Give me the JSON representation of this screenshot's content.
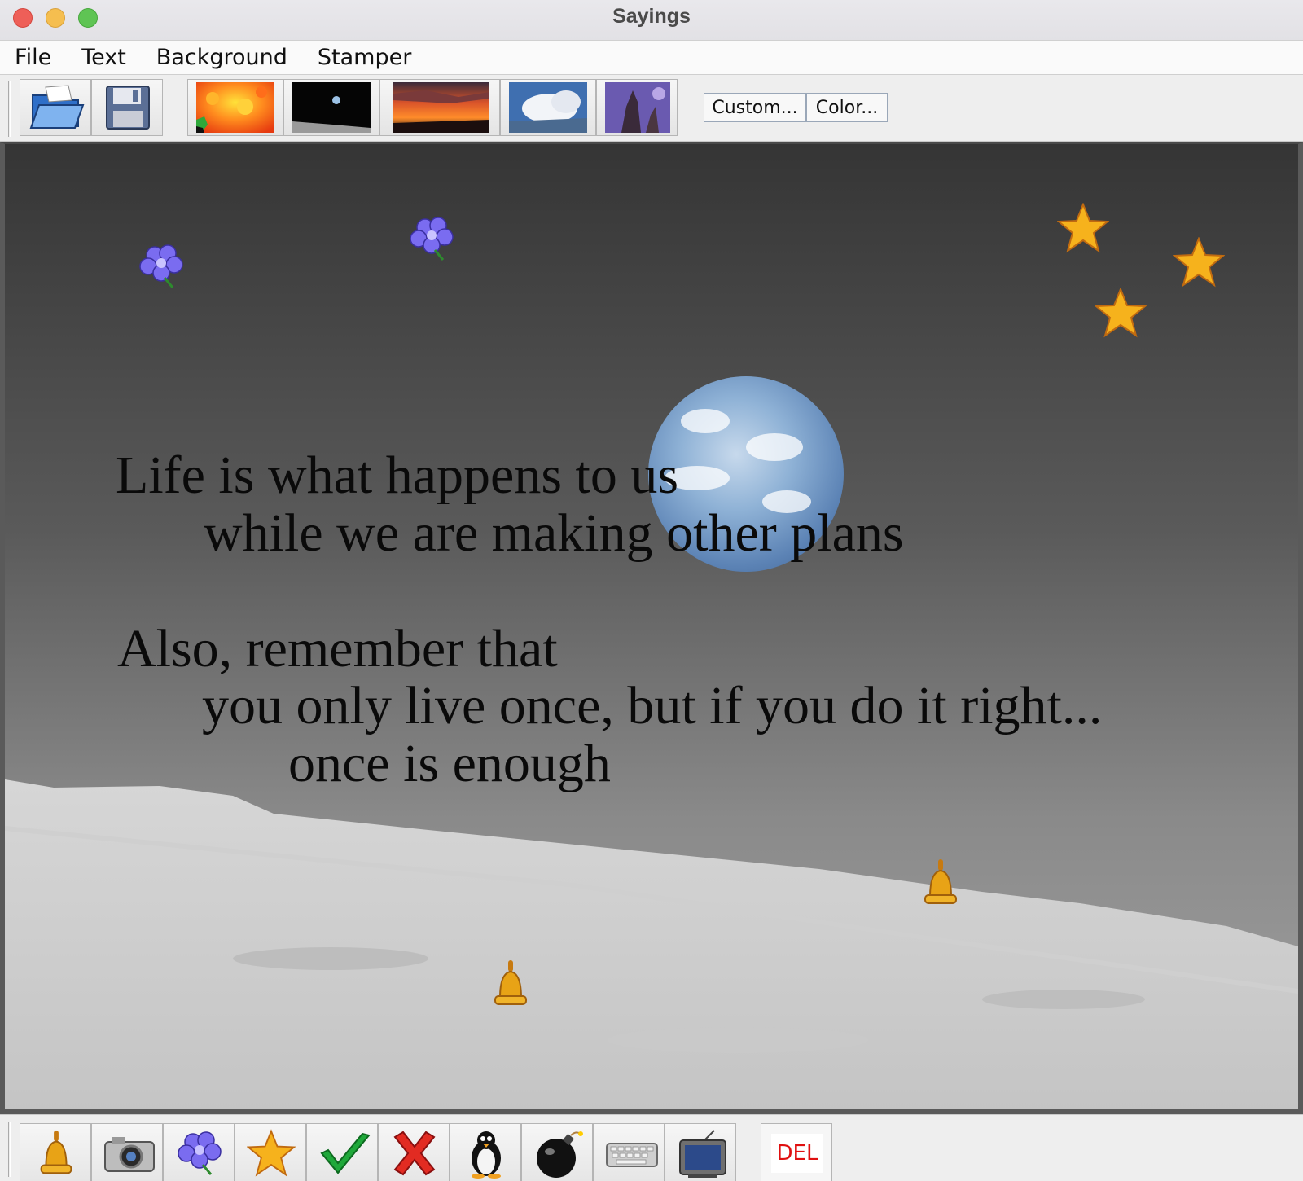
{
  "window": {
    "title": "Sayings"
  },
  "menu": {
    "items": [
      "File",
      "Text",
      "Background",
      "Stamper"
    ]
  },
  "toolbar": {
    "open_icon": "open-folder-icon",
    "save_icon": "floppy-disk-icon",
    "backgrounds": [
      "fractal",
      "earthrise",
      "sunset",
      "clouds",
      "nebula"
    ],
    "custom_label": "Custom...",
    "color_label": "Color..."
  },
  "canvas": {
    "background": "earthrise",
    "lines": [
      "Life is what happens to us",
      "while we are making other plans",
      "Also, remember that",
      "you only live once, but if you do it right...",
      "once is enough"
    ],
    "stamps": [
      "flower",
      "flower",
      "star",
      "star",
      "star",
      "bell",
      "bell"
    ]
  },
  "stamper": {
    "tools": [
      "bell-icon",
      "camera-icon",
      "flower-icon",
      "star-icon",
      "checkmark-icon",
      "x-mark-icon",
      "penguin-icon",
      "bomb-icon",
      "keyboard-icon",
      "television-icon"
    ],
    "del_label": "DEL"
  },
  "colors": {
    "del_text": "#e01010",
    "star": "#f6b21c",
    "bell": "#e8a316",
    "flower": "#7a6cf0"
  }
}
